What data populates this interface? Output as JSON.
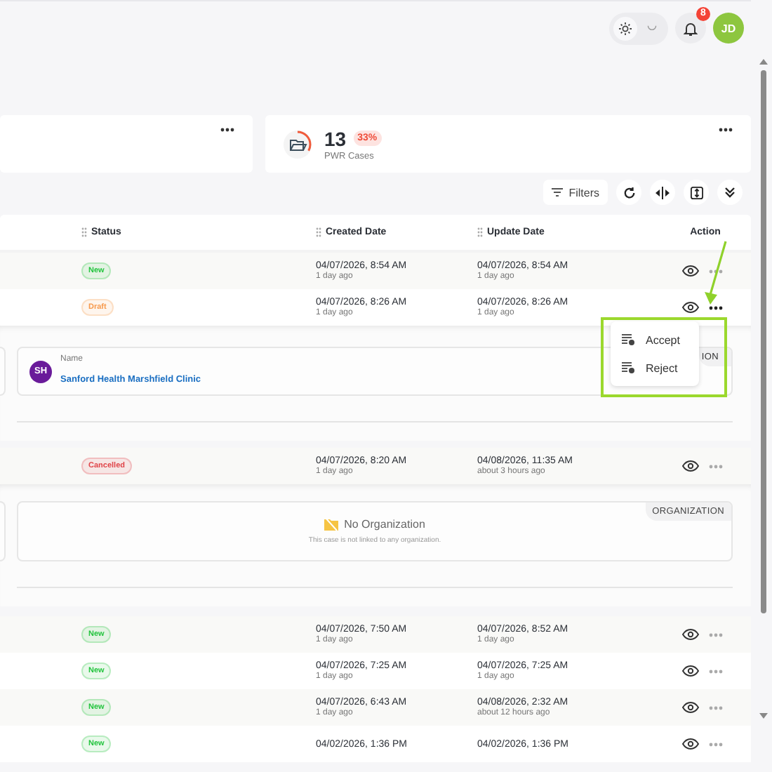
{
  "topbar": {
    "dark_mode": false,
    "notifications": "8",
    "avatar": "JD"
  },
  "stat_cards": [
    {
      "kind": "partial"
    },
    {
      "kind": "stat",
      "value": "13",
      "change": "33%",
      "label": "PWR Cases"
    }
  ],
  "toolbar": {
    "filters": "Filters"
  },
  "table": {
    "columns": [
      "Status",
      "Created Date",
      "Update Date",
      "Action"
    ],
    "rows": [
      {
        "status": "New",
        "color": "#23c43e",
        "created": "04/07/2026, 8:54 AM",
        "created_ago": "1 day ago",
        "updated": "04/07/2026, 8:54 AM",
        "updated_ago": "1 day ago",
        "menu_open": false
      },
      {
        "status": "Draft",
        "color": "#f79a4d",
        "created": "04/07/2026, 8:26 AM",
        "created_ago": "1 day ago",
        "updated": "04/07/2026, 8:26 AM",
        "updated_ago": "1 day ago",
        "menu_open": true,
        "detail": {
          "kind": "organization",
          "initials": "SH",
          "label": "Name",
          "name": "Sanford Health Marshfield Clinic",
          "tag": "ION"
        }
      },
      {
        "status": "Cancelled",
        "color": "#e0454a",
        "created": "04/07/2026, 8:20 AM",
        "created_ago": "1 day ago",
        "updated": "04/08/2026, 11:35 AM",
        "updated_ago": "about 3 hours ago",
        "menu_open": false,
        "detail": {
          "kind": "empty",
          "title": "No Organization",
          "text": "This case is not linked to any organization.",
          "tag": "ORGANIZATION"
        }
      },
      {
        "status": "New",
        "color": "#23c43e",
        "created": "04/07/2026, 7:50 AM",
        "created_ago": "1 day ago",
        "updated": "04/07/2026, 8:52 AM",
        "updated_ago": "1 day ago",
        "menu_open": false
      },
      {
        "status": "New",
        "color": "#23c43e",
        "created": "04/07/2026, 7:25 AM",
        "created_ago": "1 day ago",
        "updated": "04/07/2026, 7:25 AM",
        "updated_ago": "1 day ago",
        "menu_open": false
      },
      {
        "status": "New",
        "color": "#23c43e",
        "created": "04/07/2026, 6:43 AM",
        "created_ago": "1 day ago",
        "updated": "04/08/2026, 2:32 AM",
        "updated_ago": "about 12 hours ago",
        "menu_open": false
      },
      {
        "status": "New",
        "color": "#23c43e",
        "created": "04/02/2026, 1:36 PM",
        "updated": "04/02/2026, 1:36 PM",
        "menu_open": false
      }
    ]
  },
  "row_menu": {
    "items": [
      "Accept",
      "Reject"
    ],
    "highlighted": true
  }
}
